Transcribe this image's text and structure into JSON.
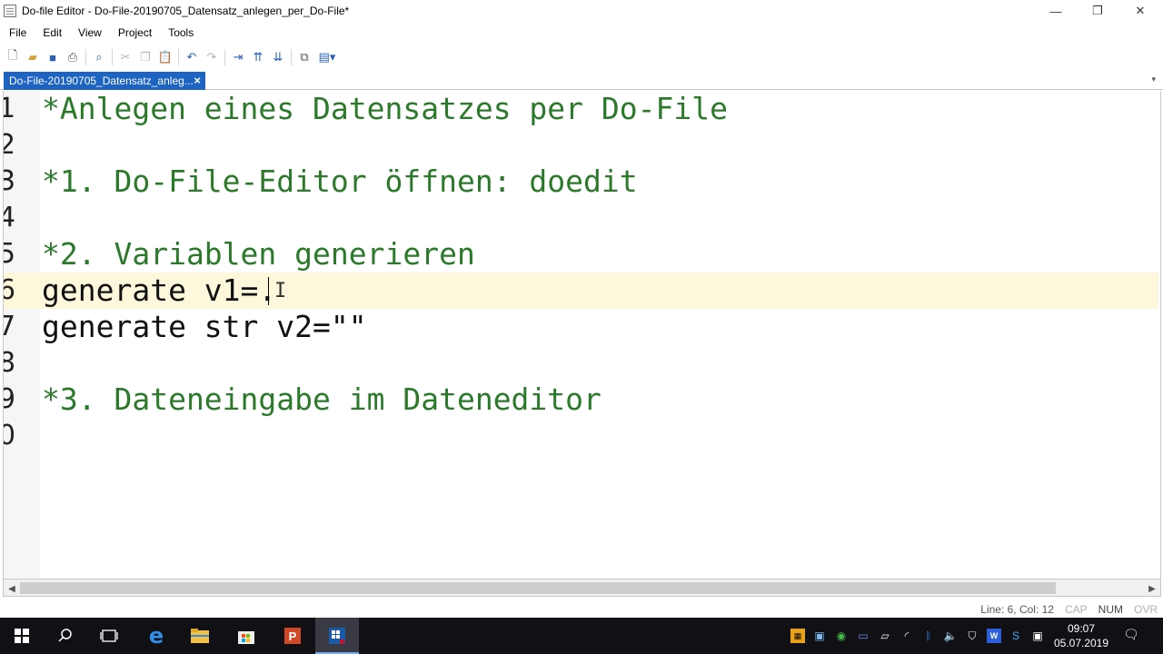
{
  "window": {
    "title": "Do-file Editor - Do-File-20190705_Datensatz_anlegen_per_Do-File*",
    "minimize_glyph": "—",
    "maximize_glyph": "❐",
    "close_glyph": "✕"
  },
  "menu": [
    "File",
    "Edit",
    "View",
    "Project",
    "Tools"
  ],
  "toolbar": {
    "icons": [
      "new-file-icon",
      "open-folder-icon",
      "save-icon",
      "print-icon",
      "find-icon",
      "cut-icon",
      "copy-icon",
      "paste-icon",
      "undo-icon",
      "redo-icon",
      "indent-icon",
      "move-up-icon",
      "move-down-icon",
      "bookmark-icon",
      "execute-icon"
    ]
  },
  "tab": {
    "label": "Do-File-20190705_Datensatz_anleg...",
    "close_glyph": "×",
    "dropdown_glyph": "▾"
  },
  "editor": {
    "current_line": 6,
    "lines": [
      {
        "num": "1",
        "text": "*Anlegen eines Datensatzes per Do-File",
        "comment": true
      },
      {
        "num": "2",
        "text": "",
        "comment": false
      },
      {
        "num": "3",
        "text": "*1. Do-File-Editor öffnen: doedit",
        "comment": true
      },
      {
        "num": "4",
        "text": "",
        "comment": false
      },
      {
        "num": "5",
        "text": "*2. Variablen generieren",
        "comment": true
      },
      {
        "num": "6",
        "text": "generate v1=.",
        "comment": false
      },
      {
        "num": "7",
        "text": "generate str v2=\"\"",
        "comment": false
      },
      {
        "num": "8",
        "text": "",
        "comment": false
      },
      {
        "num": "9",
        "text": "*3. Dateneingabe im Dateneditor",
        "comment": true
      },
      {
        "num": "0",
        "text": "",
        "comment": false
      }
    ]
  },
  "status": {
    "position": "Line: 6, Col: 12",
    "cap": "CAP",
    "num": "NUM",
    "ovr": "OVR"
  },
  "taskbar": {
    "time": "09:07",
    "date": "05.07.2019",
    "apps": [
      "start-icon",
      "search-icon",
      "task-view-icon",
      "edge-icon",
      "file-explorer-icon",
      "store-icon",
      "powerpoint-icon",
      "stata-icon"
    ],
    "tray_icons": [
      "tray-app-icon-1",
      "tray-app-icon-2",
      "tray-app-icon-3",
      "tray-app-icon-4",
      "network-icon",
      "bluetooth-icon",
      "volume-icon",
      "defender-icon",
      "tray-app-icon-5",
      "tray-app-icon-6",
      "tray-app-icon-7"
    ]
  },
  "colors": {
    "accent": "#1c63c2",
    "comment": "#2a7a2a",
    "current_line": "#fdf8dc",
    "taskbar": "#101015"
  }
}
